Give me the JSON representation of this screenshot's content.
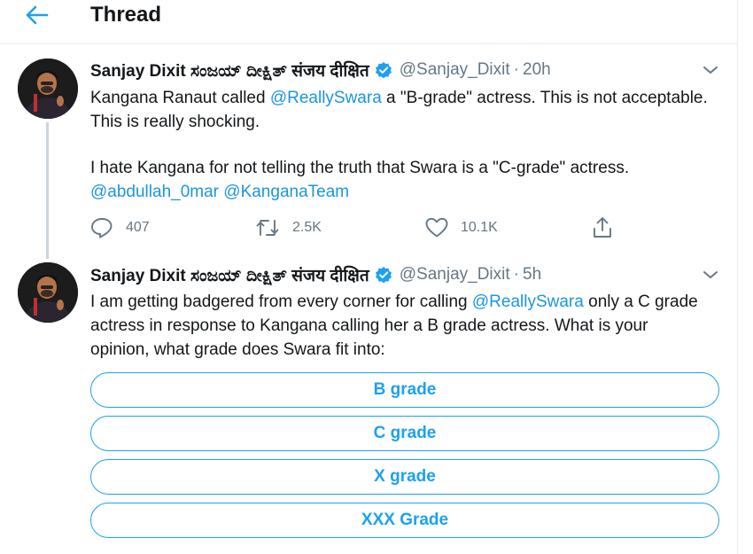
{
  "header": {
    "title": "Thread",
    "back_icon": "arrow-left-icon"
  },
  "colors": {
    "accent": "#1da1f2",
    "mention": "#1b95e0",
    "muted": "#657786",
    "text": "#14171a"
  },
  "tweets": [
    {
      "author": "Sanjay Dixit ಸಂಜಯ್ ದೀಕ್ಷಿತ್ संजय दीक्षित",
      "handle": "@Sanjay_Dixit",
      "separator": "·",
      "time": "20h",
      "verified": true,
      "text": {
        "p1_a": "Kangana Ranaut called ",
        "p1_mention": "@ReallySwara",
        "p1_b": " a \"B-grade\" actress. This is not acceptable. This is really shocking.",
        "p2": "I hate Kangana for not telling the truth that Swara is a \"C-grade\" actress.",
        "p3_mention1": "@abdullah_0mar",
        "p3_mention2": "@KanganaTeam"
      },
      "actions": {
        "replies": "407",
        "retweets": "2.5K",
        "likes": "10.1K"
      }
    },
    {
      "author": "Sanjay Dixit ಸಂಜಯ್ ದೀಕ್ಷಿತ್ संजय दीक्षित",
      "handle": "@Sanjay_Dixit",
      "separator": "·",
      "time": "5h",
      "verified": true,
      "text": {
        "a": "I am getting badgered from every corner for calling ",
        "mention": "@ReallySwara",
        "b": " only a C grade actress in response to Kangana calling her a B grade actress. What is your opinion, what grade does Swara fit into:"
      },
      "poll": [
        "B grade",
        "C grade",
        "X grade",
        "XXX Grade"
      ]
    }
  ]
}
